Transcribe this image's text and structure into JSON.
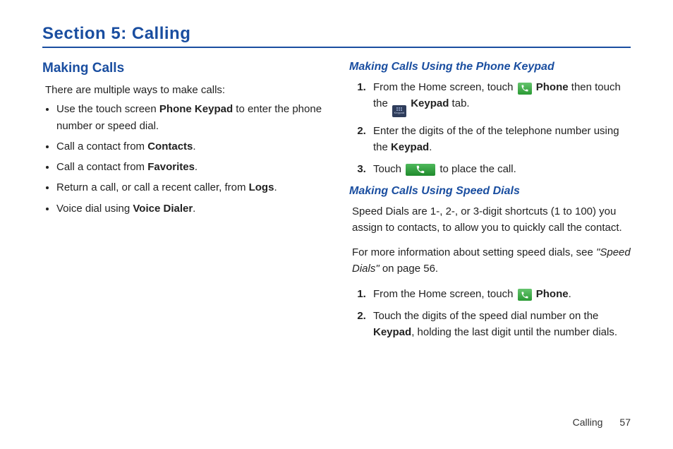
{
  "section_title": "Section 5: Calling",
  "left": {
    "heading": "Making Calls",
    "intro": "There are multiple ways to make calls:",
    "bullets": [
      {
        "pre": "Use the touch screen ",
        "bold": "Phone Keypad",
        "post": " to enter the phone number or speed dial."
      },
      {
        "pre": "Call a contact from ",
        "bold": "Contacts",
        "post": "."
      },
      {
        "pre": "Call a contact from ",
        "bold": "Favorites",
        "post": "."
      },
      {
        "pre": "Return a call, or call a recent caller, from ",
        "bold": "Logs",
        "post": "."
      },
      {
        "pre": "Voice dial using ",
        "bold": "Voice Dialer",
        "post": "."
      }
    ]
  },
  "right": {
    "keypad_heading": "Making Calls Using the Phone Keypad",
    "keypad_steps": {
      "s1_pre": "From the Home screen, touch ",
      "s1_phone": "Phone",
      "s1_mid": " then touch the ",
      "s1_keypad": "Keypad",
      "s1_post": " tab.",
      "s2_pre": "Enter the digits of the of the telephone number using the ",
      "s2_bold": "Keypad",
      "s2_post": ".",
      "s3_pre": "Touch ",
      "s3_post": " to place the call."
    },
    "speed_heading": "Making Calls Using Speed Dials",
    "speed_intro": "Speed Dials are 1-, 2-, or 3-digit shortcuts (1 to 100) you assign to contacts, to allow you to quickly call the contact.",
    "speed_more_pre": "For more information about setting speed dials, see ",
    "speed_more_ref": "\"Speed Dials\"",
    "speed_more_post": " on page 56.",
    "speed_steps": {
      "s1_pre": "From the Home screen, touch ",
      "s1_bold": "Phone",
      "s1_post": ".",
      "s2_pre": "Touch the digits of the speed dial number on the ",
      "s2_bold": "Keypad",
      "s2_post": ", holding the last digit until the number dials."
    }
  },
  "footer": {
    "label": "Calling",
    "page": "57"
  },
  "icons": {
    "phone_green": "phone-handset-icon",
    "keypad_tab": "keypad-tab-icon",
    "call_button": "call-button-icon"
  }
}
